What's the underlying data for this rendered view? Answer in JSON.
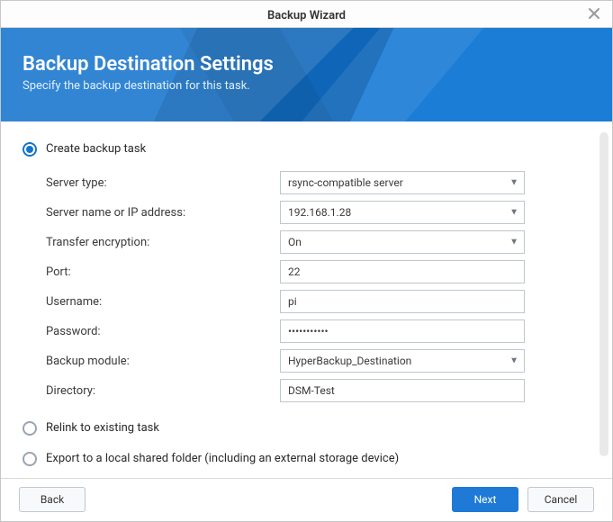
{
  "window": {
    "title": "Backup Wizard"
  },
  "banner": {
    "heading": "Backup Destination Settings",
    "subheading": "Specify the backup destination for this task."
  },
  "task_options": {
    "create_label": "Create backup task",
    "relink_label": "Relink to existing task",
    "export_label": "Export to a local shared folder (including an external storage device)",
    "selected": "create"
  },
  "form": {
    "server_type": {
      "label": "Server type:",
      "value": "rsync-compatible server"
    },
    "server_addr": {
      "label": "Server name or IP address:",
      "value": "192.168.1.28"
    },
    "encryption": {
      "label": "Transfer encryption:",
      "value": "On"
    },
    "port": {
      "label": "Port:",
      "value": "22"
    },
    "username": {
      "label": "Username:",
      "value": "pi"
    },
    "password": {
      "label": "Password:",
      "value": "•••••••••••"
    },
    "module": {
      "label": "Backup module:",
      "value": "HyperBackup_Destination"
    },
    "directory": {
      "label": "Directory:",
      "value": "DSM-Test"
    }
  },
  "footer": {
    "back": "Back",
    "next": "Next",
    "cancel": "Cancel"
  }
}
